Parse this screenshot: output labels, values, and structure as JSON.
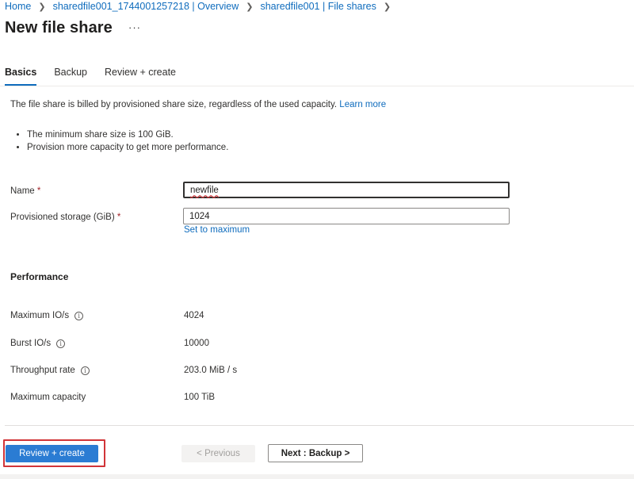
{
  "breadcrumb": {
    "items": [
      "Home",
      "sharedfile001_1744001257218 | Overview",
      "sharedfile001 | File shares"
    ],
    "separator": ">"
  },
  "page": {
    "title": "New file share",
    "more_label": "···"
  },
  "tabs": [
    {
      "label": "Basics",
      "active": true
    },
    {
      "label": "Backup",
      "active": false
    },
    {
      "label": "Review + create",
      "active": false
    }
  ],
  "intro": {
    "text": "The file share is billed by provisioned share size, regardless of the used capacity.",
    "link": "Learn more"
  },
  "bullets": [
    "The minimum share size is 100 GiB.",
    "Provision more capacity to get more performance."
  ],
  "form": {
    "name_label": "Name",
    "name_value": "newfile",
    "storage_label": "Provisioned storage (GiB)",
    "storage_value": "1024",
    "required_marker": "*",
    "set_max_link": "Set to maximum"
  },
  "performance": {
    "title": "Performance",
    "rows": [
      {
        "label": "Maximum IO/s",
        "value": "4024",
        "info": true
      },
      {
        "label": "Burst IO/s",
        "value": "10000",
        "info": true
      },
      {
        "label": "Throughput rate",
        "value": "203.0 MiB / s",
        "info": true
      },
      {
        "label": "Maximum capacity",
        "value": "100 TiB",
        "info": false
      }
    ]
  },
  "footer": {
    "review_create": "Review + create",
    "previous": "< Previous",
    "next": "Next : Backup >"
  },
  "icons": {
    "chevron": "chevron-right-icon",
    "info": "info-icon"
  },
  "colors": {
    "accent": "#0f6cbd",
    "primary_button": "#2b7cd3",
    "highlight": "#d13438",
    "required": "#a4262c"
  }
}
